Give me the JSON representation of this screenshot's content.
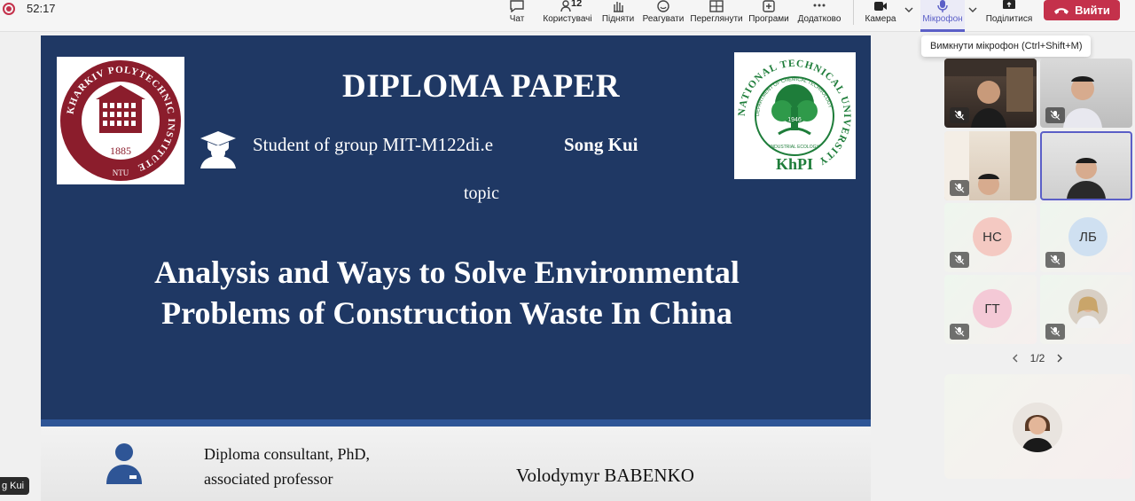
{
  "meeting": {
    "timer": "52:17"
  },
  "toolbar": {
    "chat": "Чат",
    "people": "Користувачі",
    "people_count": "12",
    "raise": "Підняти",
    "react": "Реагувати",
    "view": "Переглянути",
    "apps": "Програми",
    "more": "Додатково",
    "camera": "Камера",
    "mic": "Мікрофон",
    "share": "Поділитися",
    "leave": "Вийти",
    "mic_tooltip": "Вимкнути мікрофон (Ctrl+Shift+M)"
  },
  "slide": {
    "title": "DIPLOMA PAPER",
    "student_label": "Student of group MIT-M122di.e",
    "student_name": "Song Kui",
    "topic_label": "topic",
    "thesis_line1": "Analysis and Ways to Solve Environmental",
    "thesis_line2": "Problems of Construction Waste In China",
    "consultant_line1": "Diploma consultant, PhD,",
    "consultant_line2": "associated professor",
    "supervisor": "Volodymyr BABENKO",
    "logo_left": {
      "ring_text": "KHARKIV POLYTECHNIC INSTITUTE",
      "year": "1885",
      "abbr": "NTU"
    },
    "logo_right": {
      "ring_text": "NATIONAL TECHNICAL UNIVERSITY",
      "inner_text": "DEPARTMENT OF CHEMICAL TECHNOLOGY",
      "inner_bottom": "INDUSTRIAL ECOLOGY",
      "years": "1946",
      "name": "KhPI"
    }
  },
  "presenter_tag": "g Kui",
  "participants": {
    "initials": [
      "НС",
      "ЛБ",
      "ГТ"
    ],
    "page": "1/2"
  },
  "colors": {
    "slide_bg": "#1f3864",
    "accent": "#5b5fc7",
    "leave": "#c4314b"
  }
}
